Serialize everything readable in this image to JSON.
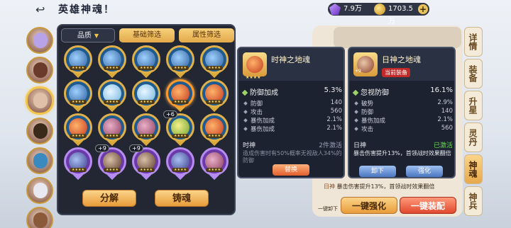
{
  "header": {
    "title": "英雄神魂！",
    "crystal_amount": "7.9万",
    "coin_amount": "1703.5万"
  },
  "filters": {
    "quality_label": "品质",
    "basic_label": "基础筛选",
    "attribute_label": "属性筛选"
  },
  "soul_grid": [
    {
      "type": "dragon",
      "frame": "gold",
      "level": ""
    },
    {
      "type": "dragon",
      "frame": "gold",
      "level": ""
    },
    {
      "type": "dragon",
      "frame": "gold",
      "level": ""
    },
    {
      "type": "dragon",
      "frame": "gold",
      "level": ""
    },
    {
      "type": "dragon",
      "frame": "gold",
      "level": ""
    },
    {
      "type": "dragon",
      "frame": "gold",
      "level": ""
    },
    {
      "type": "wind",
      "frame": "gold",
      "level": ""
    },
    {
      "type": "wind",
      "frame": "gold",
      "level": ""
    },
    {
      "type": "fire",
      "frame": "gold",
      "level": "",
      "selected": true
    },
    {
      "type": "fire",
      "frame": "gold",
      "level": ""
    },
    {
      "type": "fire",
      "frame": "gold",
      "level": ""
    },
    {
      "type": "demon",
      "frame": "gold",
      "level": ""
    },
    {
      "type": "demon",
      "frame": "gold",
      "level": ""
    },
    {
      "type": "leaf",
      "frame": "gold",
      "level": "+6"
    },
    {
      "type": "fire",
      "frame": "gold",
      "level": ""
    },
    {
      "type": "eagle",
      "frame": "purple",
      "level": ""
    },
    {
      "type": "bird",
      "frame": "purple",
      "level": "+9"
    },
    {
      "type": "bird",
      "frame": "purple",
      "level": "+9"
    },
    {
      "type": "eagle",
      "frame": "purple",
      "level": ""
    },
    {
      "type": "demon",
      "frame": "purple",
      "level": ""
    }
  ],
  "actions": {
    "decompose_label": "分解",
    "forge_label": "铸魂"
  },
  "compare_left": {
    "name": "时神之地魂",
    "main_stat": {
      "label": "防御加成",
      "value": "5.3%"
    },
    "sub_stats": [
      {
        "label": "防御",
        "value": "140"
      },
      {
        "label": "攻击",
        "value": "560"
      },
      {
        "label": "暴伤加成",
        "value": "2.1%"
      },
      {
        "label": "暴伤加成",
        "value": "2.1%"
      }
    ],
    "set_name": "时神",
    "set_status": "2件激活",
    "set_desc": "造成伤害时有50%概率无视敌人34%的防御",
    "replace_label": "替换"
  },
  "compare_right": {
    "name": "日神之地魂",
    "level": "+9",
    "equipped_label": "当前装备",
    "main_stat": {
      "label": "忽视防御",
      "value": "16.1%"
    },
    "sub_stats": [
      {
        "label": "破势",
        "value": "2.9%"
      },
      {
        "label": "防御",
        "value": "140"
      },
      {
        "label": "暴伤加成",
        "value": "2.1%"
      },
      {
        "label": "攻击",
        "value": "560"
      }
    ],
    "set_name": "日神",
    "set_status": "已激活",
    "set_desc": "暴击伤害提升13%，首领战时效果翻倍",
    "unequip_label": "卸下",
    "upgrade_label": "强化"
  },
  "set_bonus": {
    "tag": "日神",
    "text": "暴击伤害提升13%，首领战时效果翻倍"
  },
  "bottom": {
    "one_key_label": "一键卸下",
    "quick_upgrade_label": "一键强化",
    "quick_equip_label": "一键装配"
  },
  "side_tabs": [
    {
      "label": "详情",
      "active": false
    },
    {
      "label": "装备",
      "active": false
    },
    {
      "label": "升星",
      "active": false
    },
    {
      "label": "灵丹",
      "active": false
    },
    {
      "label": "神魂",
      "active": true
    },
    {
      "label": "神兵",
      "active": false
    }
  ],
  "hero_colors": [
    "#b9a3e8",
    "#6a3a2a",
    "#e0c0a8",
    "#3a2a1a",
    "#3a8ac0",
    "#e8e8f0",
    "#8a5a3a"
  ]
}
